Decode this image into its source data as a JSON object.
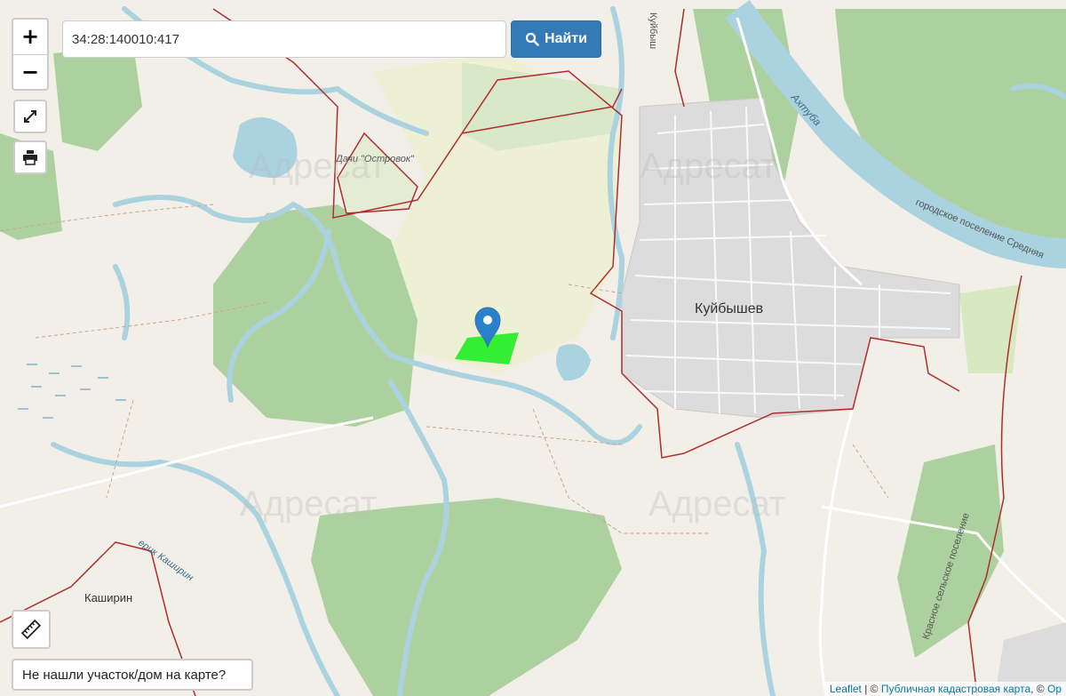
{
  "search": {
    "value": "34:28:140010:417"
  },
  "find_button": {
    "label": "Найти"
  },
  "controls": {
    "zoom_in": "+",
    "zoom_out": "−"
  },
  "not_found_button": {
    "label": "Не нашли участок/дом на карте?"
  },
  "attribution": {
    "leaflet": "Leaflet",
    "sep1": " | © ",
    "pkk": "Публичная кадастровая карта",
    "sep2": ", © ",
    "osm": "Op"
  },
  "map_labels": {
    "city": "Куйбышев",
    "dacha": "Дачи \"Островок\"",
    "river": "Ахтуба",
    "settlement_top": "городское поселение Средняя",
    "village": "Каширин",
    "creek": "ерик Каширин",
    "road_top": "Куйбыш",
    "settlement_right": "Красное сельское поселение"
  },
  "watermark": "Адресат",
  "colors": {
    "land": "#f2efe9",
    "forest": "#add19e",
    "water": "#aad3df",
    "urban": "#dcdcdc",
    "parcel": "#33ee33",
    "marker": "#2a81cb",
    "boundary": "#b22c2c"
  }
}
